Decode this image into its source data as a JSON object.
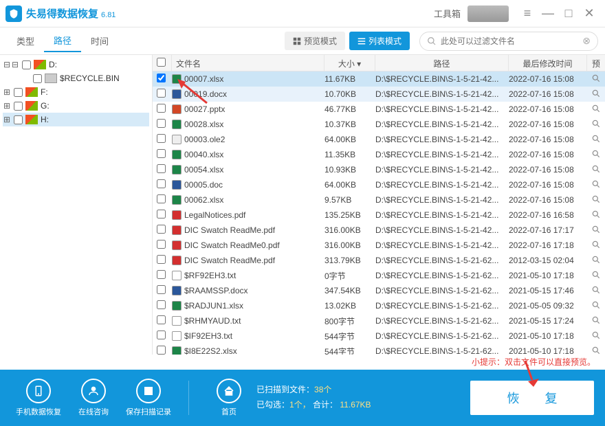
{
  "app": {
    "title": "失易得数据恢复",
    "version": "6.81",
    "toolbox": "工具箱"
  },
  "tabs": {
    "type": "类型",
    "path": "路径",
    "time": "时间",
    "active": "path"
  },
  "modes": {
    "preview": "预览模式",
    "list": "列表模式"
  },
  "search": {
    "placeholder": "此处可以过滤文件名"
  },
  "tree": [
    {
      "exp": "-",
      "label": "D:",
      "icon": "win"
    },
    {
      "exp": "",
      "label": "$RECYCLE.BIN",
      "icon": "plain",
      "indent": 2
    },
    {
      "exp": "+",
      "label": "F:",
      "icon": "win"
    },
    {
      "exp": "+",
      "label": "G:",
      "icon": "win"
    },
    {
      "exp": "+",
      "label": "H:",
      "icon": "win",
      "selected": true
    }
  ],
  "cols": {
    "name": "文件名",
    "size": "大小",
    "path": "路径",
    "date": "最后修改时间",
    "preview": "预览"
  },
  "files": [
    {
      "cb": true,
      "ico": "xlsx",
      "name": "00007.xlsx",
      "size": "11.67KB",
      "path": "D:\\$RECYCLE.BIN\\S-1-5-21-42...",
      "date": "2022-07-16  15:08",
      "sel": true
    },
    {
      "cb": false,
      "ico": "docx",
      "name": "00019.docx",
      "size": "10.70KB",
      "path": "D:\\$RECYCLE.BIN\\S-1-5-21-42...",
      "date": "2022-07-16  15:08",
      "hov": true
    },
    {
      "cb": false,
      "ico": "pptx",
      "name": "00027.pptx",
      "size": "46.77KB",
      "path": "D:\\$RECYCLE.BIN\\S-1-5-21-42...",
      "date": "2022-07-16  15:08"
    },
    {
      "cb": false,
      "ico": "xlsx",
      "name": "00028.xlsx",
      "size": "10.37KB",
      "path": "D:\\$RECYCLE.BIN\\S-1-5-21-42...",
      "date": "2022-07-16  15:08"
    },
    {
      "cb": false,
      "ico": "gen",
      "name": "00003.ole2",
      "size": "64.00KB",
      "path": "D:\\$RECYCLE.BIN\\S-1-5-21-42...",
      "date": "2022-07-16  15:08"
    },
    {
      "cb": false,
      "ico": "xlsx",
      "name": "00040.xlsx",
      "size": "11.35KB",
      "path": "D:\\$RECYCLE.BIN\\S-1-5-21-42...",
      "date": "2022-07-16  15:08"
    },
    {
      "cb": false,
      "ico": "xlsx",
      "name": "00054.xlsx",
      "size": "10.93KB",
      "path": "D:\\$RECYCLE.BIN\\S-1-5-21-42...",
      "date": "2022-07-16  15:08"
    },
    {
      "cb": false,
      "ico": "docx",
      "name": "00005.doc",
      "size": "64.00KB",
      "path": "D:\\$RECYCLE.BIN\\S-1-5-21-42...",
      "date": "2022-07-16  15:08"
    },
    {
      "cb": false,
      "ico": "xlsx",
      "name": "00062.xlsx",
      "size": "9.57KB",
      "path": "D:\\$RECYCLE.BIN\\S-1-5-21-42...",
      "date": "2022-07-16  15:08"
    },
    {
      "cb": false,
      "ico": "pdf",
      "name": "LegalNotices.pdf",
      "size": "135.25KB",
      "path": "D:\\$RECYCLE.BIN\\S-1-5-21-42...",
      "date": "2022-07-16  16:58"
    },
    {
      "cb": false,
      "ico": "pdf",
      "name": "DIC Swatch ReadMe.pdf",
      "size": "316.00KB",
      "path": "D:\\$RECYCLE.BIN\\S-1-5-21-42...",
      "date": "2022-07-16  17:17"
    },
    {
      "cb": false,
      "ico": "pdf",
      "name": "DIC Swatch ReadMe0.pdf",
      "size": "316.00KB",
      "path": "D:\\$RECYCLE.BIN\\S-1-5-21-42...",
      "date": "2022-07-16  17:18"
    },
    {
      "cb": false,
      "ico": "pdf",
      "name": "DIC Swatch ReadMe.pdf",
      "size": "313.79KB",
      "path": "D:\\$RECYCLE.BIN\\S-1-5-21-62...",
      "date": "2012-03-15  02:04"
    },
    {
      "cb": false,
      "ico": "txt",
      "name": "$RF92EH3.txt",
      "size": "0字节",
      "path": "D:\\$RECYCLE.BIN\\S-1-5-21-62...",
      "date": "2021-05-10  17:18"
    },
    {
      "cb": false,
      "ico": "docx",
      "name": "$RAAMSSP.docx",
      "size": "347.54KB",
      "path": "D:\\$RECYCLE.BIN\\S-1-5-21-62...",
      "date": "2021-05-15  17:46"
    },
    {
      "cb": false,
      "ico": "xlsx",
      "name": "$RADJUN1.xlsx",
      "size": "13.02KB",
      "path": "D:\\$RECYCLE.BIN\\S-1-5-21-62...",
      "date": "2021-05-05  09:32"
    },
    {
      "cb": false,
      "ico": "txt",
      "name": "$RHMYAUD.txt",
      "size": "800字节",
      "path": "D:\\$RECYCLE.BIN\\S-1-5-21-62...",
      "date": "2021-05-15  17:24"
    },
    {
      "cb": false,
      "ico": "txt",
      "name": "$IF92EH3.txt",
      "size": "544字节",
      "path": "D:\\$RECYCLE.BIN\\S-1-5-21-62...",
      "date": "2021-05-10  17:18"
    },
    {
      "cb": false,
      "ico": "xlsx",
      "name": "$I8E22S2.xlsx",
      "size": "544字节",
      "path": "D:\\$RECYCLE.BIN\\S-1-5-21-62...",
      "date": "2021-05-10  17:18"
    }
  ],
  "hint": "小提示：双击文件可以直接预览。",
  "bottom": {
    "mobile": "手机数据恢复",
    "chat": "在线咨询",
    "save": "保存扫描记录",
    "home": "首页",
    "scanned_label": "已扫描到文件：",
    "scanned_count": "38个",
    "selected_label": "已勾选：",
    "selected_count": "1个，",
    "total_label": "合计：",
    "total_size": "11.67KB",
    "recover": "恢 复"
  }
}
